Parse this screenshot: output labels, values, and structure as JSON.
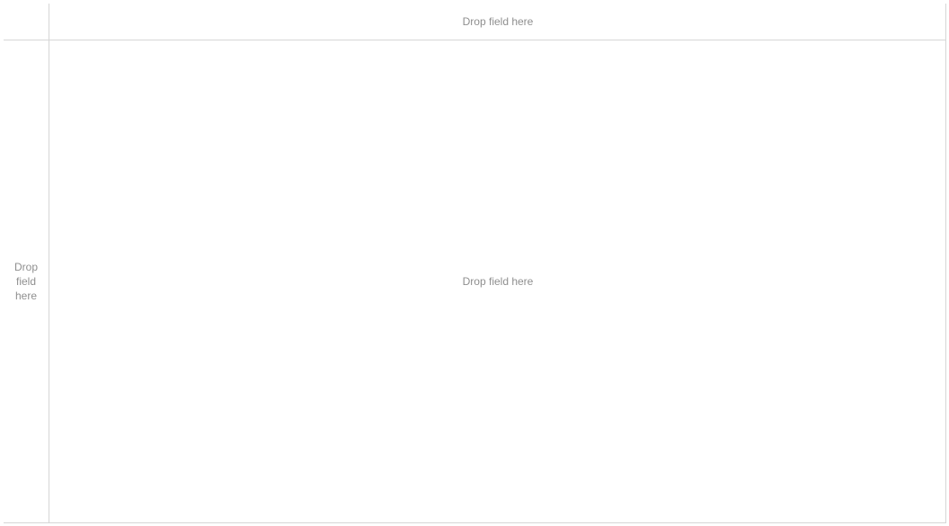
{
  "shelves": {
    "columns_placeholder": "Drop field here",
    "rows_placeholder": "Drop field here",
    "view_placeholder": "Drop field here"
  },
  "colors": {
    "grid_line": "#d6d6d6",
    "placeholder_text": "#8f8f8f",
    "background": "#ffffff"
  }
}
